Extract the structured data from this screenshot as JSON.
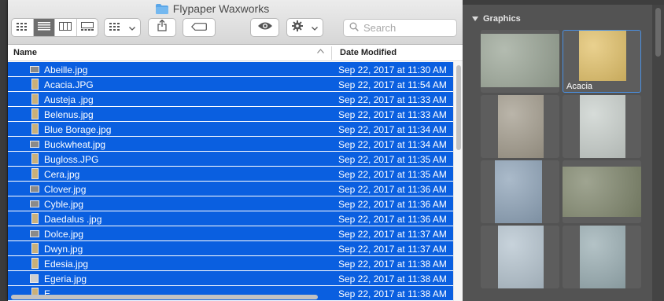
{
  "finder": {
    "title": "Flypaper Waxworks",
    "search_placeholder": "Search",
    "columns": {
      "name": "Name",
      "date": "Date Modified"
    },
    "files": [
      {
        "name": "Abeille.jpg",
        "date": "Sep 22, 2017 at 11:30 AM",
        "icon": "wide"
      },
      {
        "name": "Acacia.JPG",
        "date": "Sep 22, 2017 at 11:54 AM",
        "icon": "tall"
      },
      {
        "name": "Austeja .jpg",
        "date": "Sep 22, 2017 at 11:33 AM",
        "icon": "tall"
      },
      {
        "name": "Belenus.jpg",
        "date": "Sep 22, 2017 at 11:33 AM",
        "icon": "tall"
      },
      {
        "name": "Blue Borage.jpg",
        "date": "Sep 22, 2017 at 11:34 AM",
        "icon": "tall"
      },
      {
        "name": "Buckwheat.jpg",
        "date": "Sep 22, 2017 at 11:34 AM",
        "icon": "wide"
      },
      {
        "name": "Bugloss.JPG",
        "date": "Sep 22, 2017 at 11:35 AM",
        "icon": "tall"
      },
      {
        "name": "Cera.jpg",
        "date": "Sep 22, 2017 at 11:35 AM",
        "icon": "tall"
      },
      {
        "name": "Clover.jpg",
        "date": "Sep 22, 2017 at 11:36 AM",
        "icon": "wide"
      },
      {
        "name": "Cyble.jpg",
        "date": "Sep 22, 2017 at 11:36 AM",
        "icon": "wide"
      },
      {
        "name": "Daedalus .jpg",
        "date": "Sep 22, 2017 at 11:36 AM",
        "icon": "tall"
      },
      {
        "name": "Dolce.jpg",
        "date": "Sep 22, 2017 at 11:37 AM",
        "icon": "wide"
      },
      {
        "name": "Dwyn.jpg",
        "date": "Sep 22, 2017 at 11:37 AM",
        "icon": "tall"
      },
      {
        "name": "Edesia.jpg",
        "date": "Sep 22, 2017 at 11:38 AM",
        "icon": "tall"
      },
      {
        "name": "Egeria.jpg",
        "date": "Sep 22, 2017 at 11:38 AM",
        "icon": "sq"
      },
      {
        "name": "E",
        "date": "Sep 22, 2017 at 11:38 AM",
        "icon": "tall"
      }
    ]
  },
  "panel": {
    "section_title": "Graphics",
    "tiles": [
      {
        "label": "",
        "color": "#9aa596"
      },
      {
        "label": "Acacia",
        "color": "#e2c169",
        "selected": true
      },
      {
        "label": "",
        "color": "#a39c8d"
      },
      {
        "label": "",
        "color": "#c9d0cc"
      },
      {
        "label": "",
        "color": "#8ea3b8"
      },
      {
        "label": "",
        "color": "#7f866c"
      },
      {
        "label": "",
        "color": "#b5c4cf"
      },
      {
        "label": "",
        "color": "#9aaeb3"
      }
    ]
  }
}
